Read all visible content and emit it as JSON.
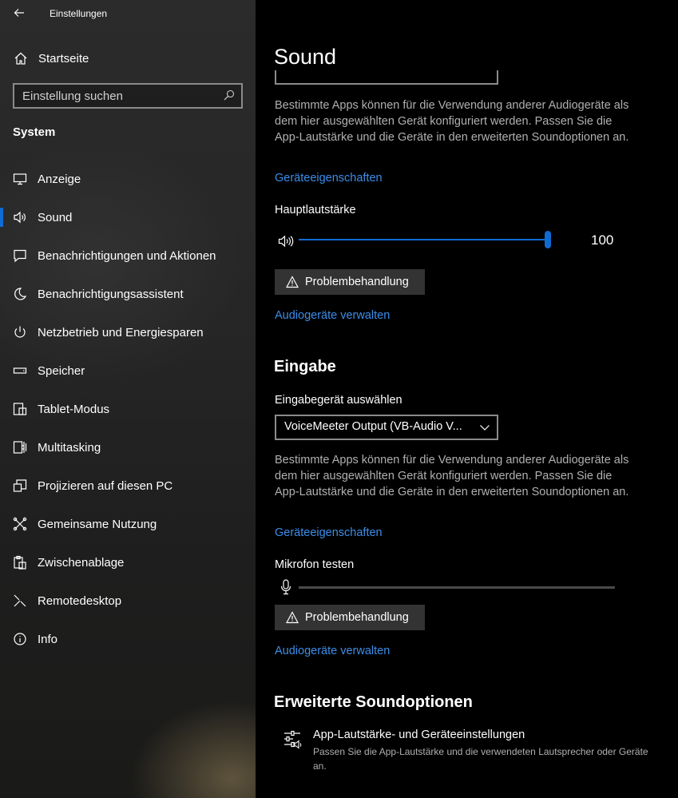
{
  "window": {
    "title": "Einstellungen"
  },
  "sidebar": {
    "home_label": "Startseite",
    "search_placeholder": "Einstellung suchen",
    "section_title": "System",
    "items": [
      {
        "label": "Anzeige",
        "icon": "monitor-icon"
      },
      {
        "label": "Sound",
        "icon": "speaker-icon",
        "active": true
      },
      {
        "label": "Benachrichtigungen und Aktionen",
        "icon": "notification-icon"
      },
      {
        "label": "Benachrichtigungsassistent",
        "icon": "moon-icon"
      },
      {
        "label": "Netzbetrieb und Energiesparen",
        "icon": "power-icon"
      },
      {
        "label": "Speicher",
        "icon": "storage-icon"
      },
      {
        "label": "Tablet-Modus",
        "icon": "tablet-icon"
      },
      {
        "label": "Multitasking",
        "icon": "multitasking-icon"
      },
      {
        "label": "Projizieren auf diesen PC",
        "icon": "project-icon"
      },
      {
        "label": "Gemeinsame Nutzung",
        "icon": "share-icon"
      },
      {
        "label": "Zwischenablage",
        "icon": "clipboard-icon"
      },
      {
        "label": "Remotedesktop",
        "icon": "remote-icon"
      },
      {
        "label": "Info",
        "icon": "info-icon"
      }
    ]
  },
  "content": {
    "page_title": "Sound",
    "output": {
      "description": "Bestimmte Apps können für die Verwendung anderer Audiogeräte als dem hier ausgewählten Gerät konfiguriert werden. Passen Sie die App-Lautstärke und die Geräte in den erweiterten Soundoptionen an.",
      "device_properties_link": "Geräteeigenschaften",
      "volume_label": "Hauptlautstärke",
      "volume_value": "100",
      "volume_level": 1.0,
      "troubleshoot_label": "Problembehandlung",
      "manage_devices_link": "Audiogeräte verwalten"
    },
    "input": {
      "heading": "Eingabe",
      "select_label": "Eingabegerät auswählen",
      "selected_device": "VoiceMeeter Output (VB-Audio V...",
      "description": "Bestimmte Apps können für die Verwendung anderer Audiogeräte als dem hier ausgewählten Gerät konfiguriert werden. Passen Sie die App-Lautstärke und die Geräte in den erweiterten Soundoptionen an.",
      "device_properties_link": "Geräteeigenschaften",
      "mic_test_label": "Mikrofon testen",
      "mic_level": 0,
      "troubleshoot_label": "Problembehandlung",
      "manage_devices_link": "Audiogeräte verwalten"
    },
    "advanced": {
      "heading": "Erweiterte Soundoptionen",
      "app_volume_title": "App-Lautstärke- und Geräteeinstellungen",
      "app_volume_desc": "Passen Sie die App-Lautstärke und die verwendeten Lautsprecher oder Geräte an."
    }
  },
  "colors": {
    "accent": "#0f6bd3",
    "link": "#3b8eea",
    "secondary_text": "#b0b0b0"
  }
}
